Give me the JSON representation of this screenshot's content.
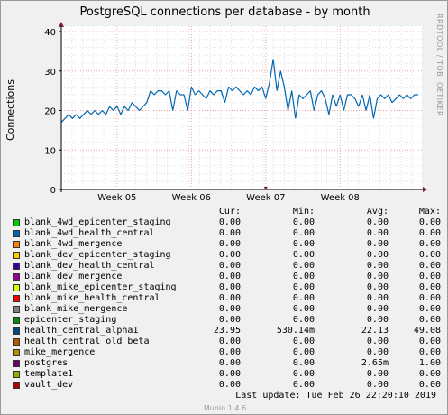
{
  "chart_data": {
    "type": "line",
    "title": "PostgreSQL connections per database - by month",
    "ylabel": "Connections",
    "ylim": [
      0,
      40
    ],
    "yticks": [
      0,
      10,
      20,
      30,
      40
    ],
    "xlim": [
      0,
      4.85
    ],
    "xticks": [
      {
        "value": 0.75,
        "label": "Week 05"
      },
      {
        "value": 1.75,
        "label": "Week 06"
      },
      {
        "value": 2.75,
        "label": "Week 07"
      },
      {
        "value": 3.75,
        "label": "Week 08"
      }
    ],
    "grid": true,
    "series": [
      {
        "name": "health_central_alpha1",
        "color": "#0066b3",
        "x": [
          0.0,
          0.05,
          0.1,
          0.15,
          0.2,
          0.25,
          0.3,
          0.35,
          0.4,
          0.45,
          0.5,
          0.55,
          0.6,
          0.65,
          0.7,
          0.75,
          0.8,
          0.85,
          0.9,
          0.95,
          1.0,
          1.05,
          1.1,
          1.15,
          1.2,
          1.25,
          1.3,
          1.35,
          1.4,
          1.45,
          1.5,
          1.55,
          1.6,
          1.65,
          1.7,
          1.75,
          1.8,
          1.85,
          1.9,
          1.95,
          2.0,
          2.05,
          2.1,
          2.15,
          2.2,
          2.25,
          2.3,
          2.35,
          2.4,
          2.45,
          2.5,
          2.55,
          2.6,
          2.65,
          2.7,
          2.75,
          2.8,
          2.85,
          2.9,
          2.95,
          3.0,
          3.05,
          3.1,
          3.15,
          3.2,
          3.25,
          3.3,
          3.35,
          3.4,
          3.45,
          3.5,
          3.55,
          3.6,
          3.65,
          3.7,
          3.75,
          3.8,
          3.85,
          3.9,
          3.95,
          4.0,
          4.05,
          4.1,
          4.15,
          4.2,
          4.25,
          4.3,
          4.35,
          4.4,
          4.45,
          4.5,
          4.55,
          4.6,
          4.65,
          4.7,
          4.75,
          4.8
        ],
        "values": [
          17,
          18,
          19,
          18,
          19,
          18,
          19,
          20,
          19,
          20,
          19,
          20,
          19,
          21,
          20,
          21,
          19,
          21,
          20,
          22,
          21,
          20,
          21,
          22,
          25,
          24,
          25,
          25,
          24,
          25,
          20,
          25,
          24,
          24,
          20,
          26,
          24,
          25,
          24,
          23,
          25,
          24,
          25,
          25,
          22,
          26,
          25,
          26,
          25,
          24,
          25,
          24,
          26,
          25,
          26,
          23,
          27,
          33,
          25,
          30,
          26,
          20,
          25,
          18,
          24,
          23,
          24,
          25,
          20,
          24,
          25,
          23,
          19,
          24,
          21,
          24,
          20,
          24,
          24,
          23,
          21,
          24,
          20,
          24,
          18,
          23,
          24,
          23,
          24,
          22,
          23,
          24,
          23,
          24,
          23,
          24,
          24
        ]
      }
    ],
    "legend": {
      "headers": [
        "Cur:",
        "Min:",
        "Avg:",
        "Max:"
      ],
      "rows": [
        {
          "name": "blank_4wd_epicenter_staging",
          "color": "#00cc00",
          "cur": "0.00",
          "min": "0.00",
          "avg": "0.00",
          "max": "0.00"
        },
        {
          "name": "blank_4wd_health_central",
          "color": "#0066b3",
          "cur": "0.00",
          "min": "0.00",
          "avg": "0.00",
          "max": "0.00"
        },
        {
          "name": "blank_4wd_mergence",
          "color": "#ff8000",
          "cur": "0.00",
          "min": "0.00",
          "avg": "0.00",
          "max": "0.00"
        },
        {
          "name": "blank_dev_epicenter_staging",
          "color": "#ffcc00",
          "cur": "0.00",
          "min": "0.00",
          "avg": "0.00",
          "max": "0.00"
        },
        {
          "name": "blank_dev_health_central",
          "color": "#330099",
          "cur": "0.00",
          "min": "0.00",
          "avg": "0.00",
          "max": "0.00"
        },
        {
          "name": "blank_dev_mergence",
          "color": "#990099",
          "cur": "0.00",
          "min": "0.00",
          "avg": "0.00",
          "max": "0.00"
        },
        {
          "name": "blank_mike_epicenter_staging",
          "color": "#ccff00",
          "cur": "0.00",
          "min": "0.00",
          "avg": "0.00",
          "max": "0.00"
        },
        {
          "name": "blank_mike_health_central",
          "color": "#ff0000",
          "cur": "0.00",
          "min": "0.00",
          "avg": "0.00",
          "max": "0.00"
        },
        {
          "name": "blank_mike_mergence",
          "color": "#808080",
          "cur": "0.00",
          "min": "0.00",
          "avg": "0.00",
          "max": "0.00"
        },
        {
          "name": "epicenter_staging",
          "color": "#008f00",
          "cur": "0.00",
          "min": "0.00",
          "avg": "0.00",
          "max": "0.00"
        },
        {
          "name": "health_central_alpha1",
          "color": "#00487d",
          "cur": "23.95",
          "min": "530.14m",
          "avg": "22.13",
          "max": "49.08"
        },
        {
          "name": "health_central_old_beta",
          "color": "#b35a00",
          "cur": "0.00",
          "min": "0.00",
          "avg": "0.00",
          "max": "0.00"
        },
        {
          "name": "mike_mergence",
          "color": "#b38f00",
          "cur": "0.00",
          "min": "0.00",
          "avg": "0.00",
          "max": "0.00"
        },
        {
          "name": "postgres",
          "color": "#6b006b",
          "cur": "0.00",
          "min": "0.00",
          "avg": "2.65m",
          "max": "1.00"
        },
        {
          "name": "template1",
          "color": "#8fb300",
          "cur": "0.00",
          "min": "0.00",
          "avg": "0.00",
          "max": "0.00"
        },
        {
          "name": "vault_dev",
          "color": "#b30000",
          "cur": "0.00",
          "min": "0.00",
          "avg": "0.00",
          "max": "0.00"
        }
      ]
    }
  },
  "side_text": "RRDTOOL / TOBI OETIKER",
  "last_update": "Last update:  Tue Feb 26 22:20:10 2019",
  "footer": "Munin 1.4.6",
  "colors": {
    "background": "#f0f0f0",
    "plot_background": "#ffffff",
    "axis": "#000000",
    "grid_minor": "#e0e0e0",
    "grid_major": "#f0a0a0"
  }
}
